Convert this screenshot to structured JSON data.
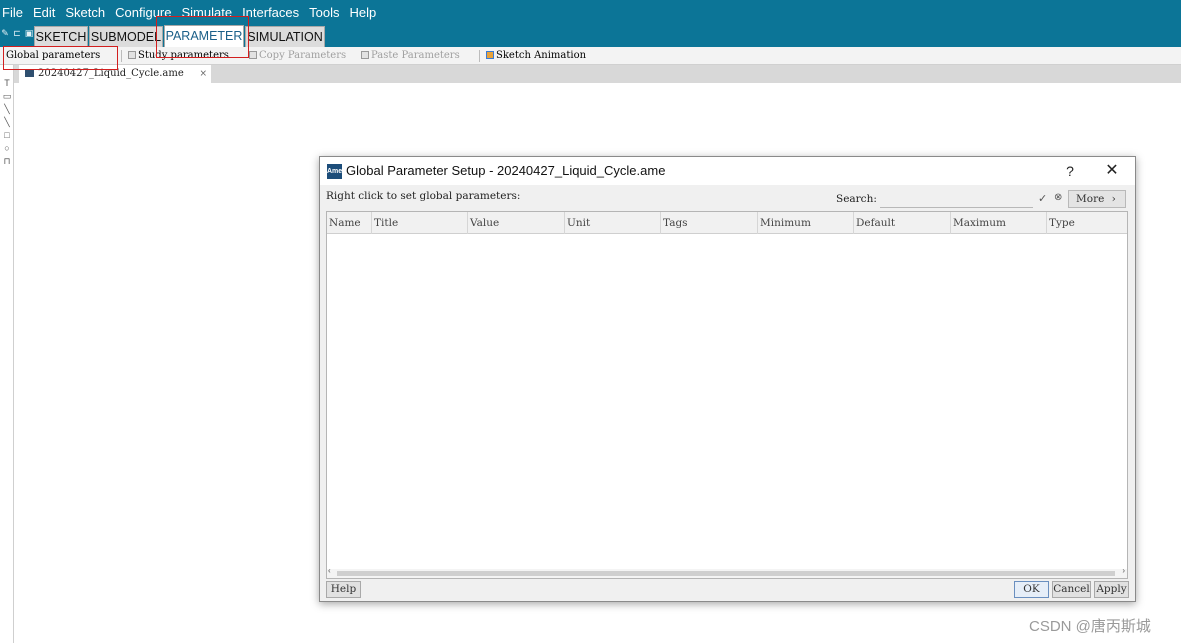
{
  "menubar": {
    "items": [
      "File",
      "Edit",
      "Sketch",
      "Configure",
      "Simulate",
      "Interfaces",
      "Tools",
      "Help"
    ]
  },
  "mode_tabs": {
    "items": [
      "SKETCH",
      "SUBMODEL",
      "PARAMETER",
      "SIMULATION"
    ],
    "active": "PARAMETER"
  },
  "toolbar": {
    "global_parameters": "Global parameters",
    "study_parameters": "Study parameters",
    "copy_parameters": "Copy Parameters",
    "paste_parameters": "Paste Parameters",
    "sketch_animation": "Sketch Animation"
  },
  "left_tools": [
    "T",
    "▭",
    "╲",
    "╲",
    "□",
    "○",
    "⊓"
  ],
  "document_tab": {
    "filename": "20240427_Liquid_Cycle.ame",
    "close": "×"
  },
  "dialog": {
    "app_icon": "Ame",
    "title": "Global Parameter Setup - 20240427_Liquid_Cycle.ame",
    "help_glyph": "?",
    "close_glyph": "✕",
    "hint": "Right click to set global parameters:",
    "search_label": "Search:",
    "search_value": "",
    "more_label": "More",
    "more_chevron": "›",
    "columns": [
      "Name",
      "Title",
      "Value",
      "Unit",
      "Tags",
      "Minimum",
      "Default",
      "Maximum",
      "Type"
    ],
    "rows": [],
    "buttons": {
      "help": "Help",
      "ok": "OK",
      "cancel": "Cancel",
      "apply": "Apply"
    }
  },
  "watermark": "CSDN @唐丙斯城",
  "colors": {
    "menubar_bg": "#0c7597",
    "highlight": "#d21f1f",
    "active_tab_text": "#1a5f88"
  }
}
